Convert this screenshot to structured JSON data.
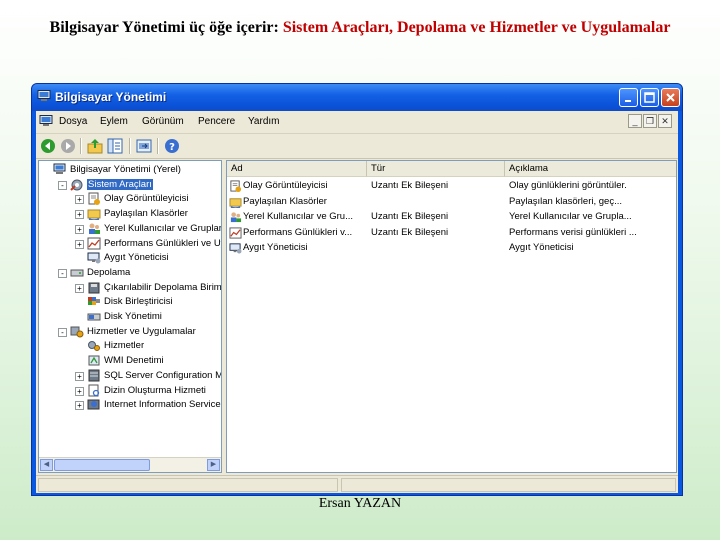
{
  "slide": {
    "title_part1": "Bilgisayar Yönetimi üç öğe içerir: ",
    "title_part2": "Sistem Araçları, Depolama ve Hizmetler ve Uygulamalar",
    "footer": "Ersan YAZAN"
  },
  "window": {
    "title": "Bilgisayar Yönetimi",
    "title_icon": "computer-management-icon"
  },
  "menu": [
    "Dosya",
    "Eylem",
    "Görünüm",
    "Pencere",
    "Yardım"
  ],
  "toolbar_icons": [
    "back-icon",
    "forward-icon",
    "up-folder-icon",
    "show-tree-icon",
    "export-icon",
    "help-icon"
  ],
  "tree": [
    {
      "label": "Bilgisayar Yönetimi (Yerel)",
      "icon": "computer-management-icon",
      "expander": "",
      "selected": false
    },
    {
      "label": "Sistem Araçları",
      "icon": "system-tools-icon",
      "expander": "-",
      "selected": true
    },
    {
      "label": "Olay Görüntüleyicisi",
      "icon": "event-viewer-icon",
      "expander": "+",
      "selected": false
    },
    {
      "label": "Paylaşılan Klasörler",
      "icon": "shared-folder-icon",
      "expander": "+",
      "selected": false
    },
    {
      "label": "Yerel Kullanıcılar ve Gruplar",
      "icon": "users-icon",
      "expander": "+",
      "selected": false
    },
    {
      "label": "Performans Günlükleri ve Uya",
      "icon": "performance-icon",
      "expander": "+",
      "selected": false
    },
    {
      "label": "Aygıt Yöneticisi",
      "icon": "device-manager-icon",
      "expander": "",
      "selected": false
    },
    {
      "label": "Depolama",
      "icon": "storage-icon",
      "expander": "-",
      "selected": false
    },
    {
      "label": "Çıkarılabilir Depolama Birimi",
      "icon": "removable-storage-icon",
      "expander": "+",
      "selected": false
    },
    {
      "label": "Disk Birleştiricisi",
      "icon": "defrag-icon",
      "expander": "",
      "selected": false
    },
    {
      "label": "Disk Yönetimi",
      "icon": "disk-management-icon",
      "expander": "",
      "selected": false
    },
    {
      "label": "Hizmetler ve Uygulamalar",
      "icon": "services-apps-icon",
      "expander": "-",
      "selected": false
    },
    {
      "label": "Hizmetler",
      "icon": "services-icon",
      "expander": "",
      "selected": false
    },
    {
      "label": "WMI Denetimi",
      "icon": "wmi-icon",
      "expander": "",
      "selected": false
    },
    {
      "label": "SQL Server Configuration Ma",
      "icon": "sql-server-icon",
      "expander": "+",
      "selected": false
    },
    {
      "label": "Dizin Oluşturma Hizmeti",
      "icon": "indexing-icon",
      "expander": "+",
      "selected": false
    },
    {
      "label": "Internet Information Service",
      "icon": "iis-icon",
      "expander": "+",
      "selected": false
    }
  ],
  "columns": [
    "Ad",
    "Tür",
    "Açıklama"
  ],
  "rows": [
    {
      "name": "Olay Görüntüleyicisi",
      "type": "Uzantı Ek Bileşeni",
      "desc": "Olay günlüklerini görüntüler.",
      "icon": "event-viewer-icon"
    },
    {
      "name": "Paylaşılan Klasörler",
      "type": "",
      "desc": "Paylaşılan klasörleri, geç...",
      "icon": "shared-folder-icon"
    },
    {
      "name": "Yerel Kullanıcılar ve Gru...",
      "type": "Uzantı Ek Bileşeni",
      "desc": "Yerel Kullanıcılar ve Grupla...",
      "icon": "users-icon"
    },
    {
      "name": "Performans Günlükleri v...",
      "type": "Uzantı Ek Bileşeni",
      "desc": "Performans verisi günlükleri ...",
      "icon": "performance-icon"
    },
    {
      "name": "Aygıt Yöneticisi",
      "type": "",
      "desc": "Aygıt Yöneticisi",
      "icon": "device-manager-icon"
    }
  ]
}
